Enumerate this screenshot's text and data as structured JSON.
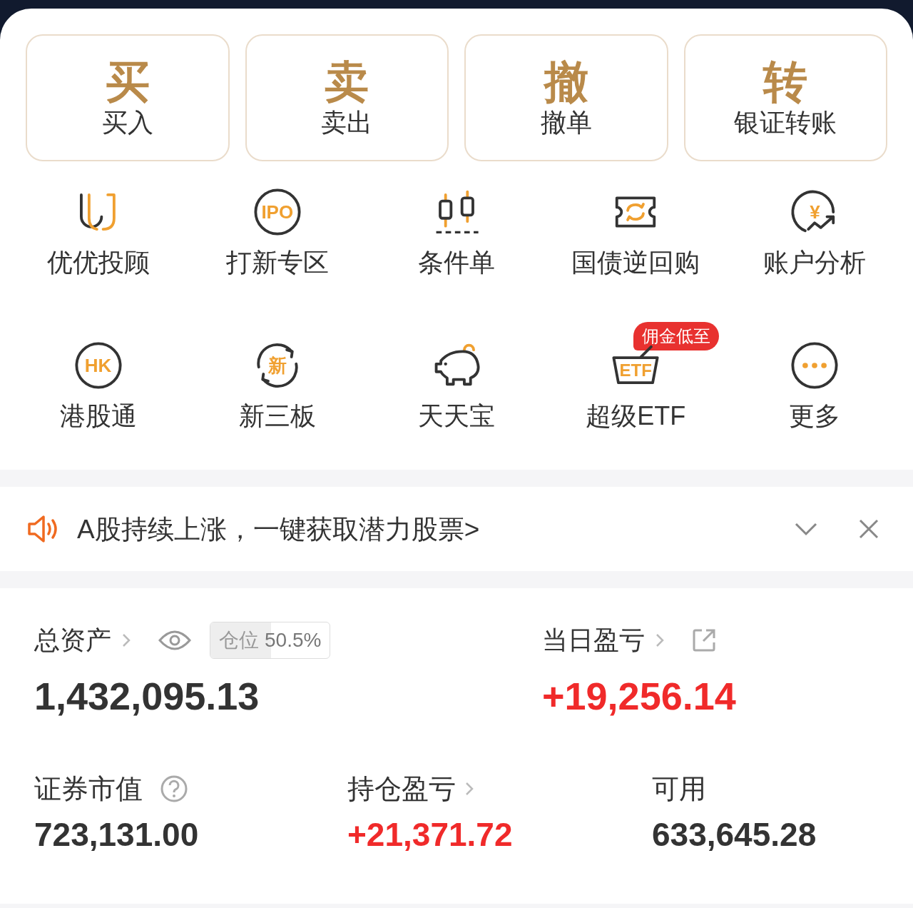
{
  "trade_buttons": [
    {
      "glyph": "买",
      "label": "买入"
    },
    {
      "glyph": "卖",
      "label": "卖出"
    },
    {
      "glyph": "撤",
      "label": "撤单"
    },
    {
      "glyph": "转",
      "label": "银证转账"
    }
  ],
  "shortcuts": [
    {
      "label": "优优投顾"
    },
    {
      "label": "打新专区",
      "icon_text": "IPO"
    },
    {
      "label": "条件单"
    },
    {
      "label": "国债逆回购"
    },
    {
      "label": "账户分析",
      "icon_text": "¥"
    },
    {
      "label": "港股通",
      "icon_text": "HK"
    },
    {
      "label": "新三板",
      "icon_text": "新"
    },
    {
      "label": "天天宝"
    },
    {
      "label": "超级ETF",
      "icon_text": "ETF",
      "badge": "佣金低至"
    },
    {
      "label": "更多"
    }
  ],
  "notice": {
    "text": "A股持续上涨，一键获取潜力股票>"
  },
  "assets": {
    "total": {
      "label": "总资产",
      "value": "1,432,095.13"
    },
    "position": {
      "label": "仓位",
      "value": "50.5%",
      "level": 0.505
    },
    "daily_pnl": {
      "label": "当日盈亏",
      "value": "+19,256.14"
    },
    "market_value": {
      "label": "证券市值",
      "value": "723,131.00"
    },
    "holding_pnl": {
      "label": "持仓盈亏",
      "value": "+21,371.72"
    },
    "available": {
      "label": "可用",
      "value": "633,645.28"
    }
  }
}
